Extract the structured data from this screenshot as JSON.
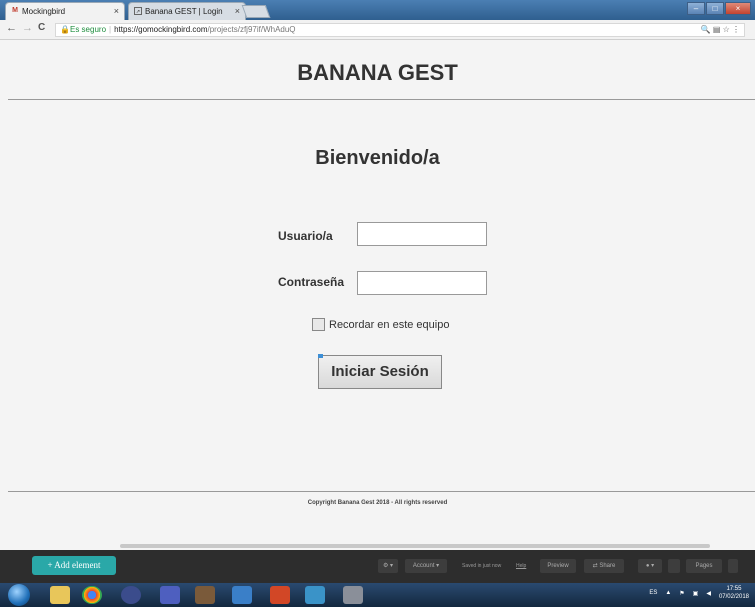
{
  "browser": {
    "tabs": [
      {
        "title": "Mockingbird",
        "icon": "mockingbird-m-icon",
        "close": "×"
      },
      {
        "title": "Banana GEST | Login",
        "icon": "page-icon",
        "close": "×"
      }
    ],
    "window_controls": {
      "minimize": "–",
      "maximize": "□",
      "close": "×"
    },
    "nav": {
      "back": "←",
      "forward": "→",
      "reload": "C"
    },
    "address": {
      "secure_label": "Es seguro",
      "url_host": "https://gomockingbird.com",
      "url_path": "/projects/zfj97if/WhAduQ"
    },
    "addr_icons": "🔍 ▤ ☆ ⋮"
  },
  "page": {
    "app_title": "BANANA GEST",
    "welcome": "Bienvenido/a",
    "username_label": "Usuario/a",
    "password_label": "Contraseña",
    "remember_label": "Recordar en este equipo",
    "login_button": "Iniciar Sesión",
    "footer": "Copyright Banana Gest 2018 - All rights reserved"
  },
  "mockingbird_toolbar": {
    "add_element": "+ Add element",
    "settings": "⚙ ▾",
    "account": "Account ▾",
    "saved": "Saved in just now",
    "help": "Help",
    "preview": "Preview",
    "share": "⇄ Share",
    "comments": "● ▾",
    "pages_label": "Pages"
  },
  "taskbar": {
    "lang": "ES",
    "time": "17:55",
    "date": "07/02/2018"
  },
  "colors": {
    "accent": "#2aa8a8",
    "secure": "#1e8e3e",
    "toolbar_bg": "#2d2d2d"
  }
}
